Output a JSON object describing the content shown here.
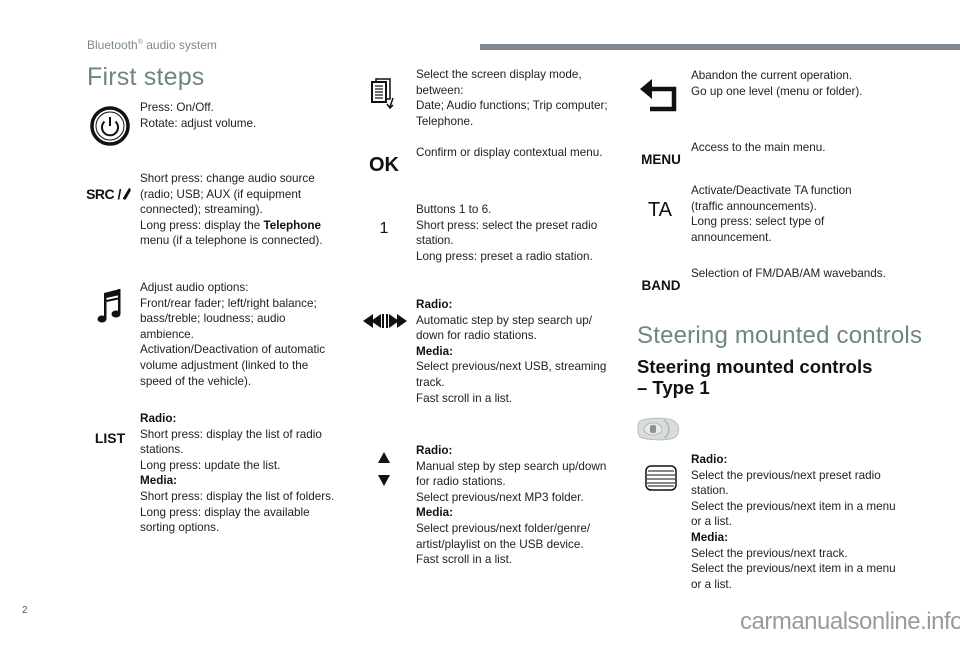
{
  "page": {
    "running_head": "Bluetooth",
    "running_head_reg": "®",
    "running_head_rest": " audio system",
    "page_number": "2",
    "watermark": "carmanualsonline.info",
    "header_bar_color": "#7d8a92",
    "heading_color": "#6f8583"
  },
  "first_steps": {
    "title": "First steps",
    "entries": [
      {
        "icon": "power-knob-icon",
        "lines": [
          {
            "bold": false,
            "text": "Press: On/Off."
          },
          {
            "bold": false,
            "text": "Rotate: adjust volume."
          }
        ]
      },
      {
        "icon": "src-telephone-icon",
        "icon_text": "SRC /",
        "lines": [
          {
            "bold": false,
            "text": "Short press: change audio source (radio; USB; AUX (if equipment connected); streaming)."
          },
          {
            "bold": false,
            "text": "Long press: display the ",
            "bold_suffix": "Telephone",
            "after": " menu (if a telephone is connected)."
          }
        ]
      },
      {
        "icon": "music-note-icon",
        "lines": [
          {
            "bold": false,
            "text": "Adjust audio options:"
          },
          {
            "bold": false,
            "text": "Front/rear fader; left/right balance; bass/treble; loudness; audio ambience."
          },
          {
            "bold": false,
            "text": "Activation/Deactivation of automatic volume adjustment (linked to the speed of the vehicle)."
          }
        ]
      },
      {
        "icon": "list-icon",
        "icon_text": "LIST",
        "lines": [
          {
            "bold": true,
            "text": "Radio:"
          },
          {
            "bold": false,
            "text": "Short press: display the list of radio stations."
          },
          {
            "bold": false,
            "text": "Long press: update the list."
          },
          {
            "bold": true,
            "text": "Media:"
          },
          {
            "bold": false,
            "text": "Short press: display the list of folders."
          },
          {
            "bold": false,
            "text": "Long press: display the available sorting options."
          }
        ]
      }
    ]
  },
  "middle_column": {
    "entries": [
      {
        "icon": "display-mode-icon",
        "lines": [
          {
            "bold": false,
            "text": "Select the screen display mode, between:"
          },
          {
            "bold": false,
            "text": "Date; Audio functions; Trip computer; Telephone."
          }
        ]
      },
      {
        "icon": "ok-icon",
        "icon_text": "OK",
        "lines": [
          {
            "bold": false,
            "text": "Confirm or display contextual menu."
          }
        ]
      },
      {
        "icon": "preset-button-icon",
        "icon_text": "1",
        "lines": [
          {
            "bold": false,
            "text": "Buttons 1 to 6."
          },
          {
            "bold": false,
            "text": "Short press: select the preset radio station."
          },
          {
            "bold": false,
            "text": "Long press: preset a radio station."
          }
        ]
      },
      {
        "icon": "seek-back-forward-icon",
        "lines": [
          {
            "bold": true,
            "text": "Radio:"
          },
          {
            "bold": false,
            "text": "Automatic step by step search up/ down for radio stations."
          },
          {
            "bold": true,
            "text": "Media:"
          },
          {
            "bold": false,
            "text": "Select previous/next USB, streaming track."
          },
          {
            "bold": false,
            "text": "Fast scroll in a list."
          }
        ]
      },
      {
        "icon": "up-down-arrows-icon",
        "lines": [
          {
            "bold": true,
            "text": "Radio:"
          },
          {
            "bold": false,
            "text": "Manual step by step search up/down for radio stations."
          },
          {
            "bold": false,
            "text": "Select previous/next MP3 folder."
          },
          {
            "bold": true,
            "text": "Media:"
          },
          {
            "bold": false,
            "text": "Select previous/next folder/genre/ artist/playlist on the USB device."
          },
          {
            "bold": false,
            "text": "Fast scroll in a list."
          }
        ]
      }
    ]
  },
  "right_column": {
    "entries": [
      {
        "icon": "back-arrow-icon",
        "lines": [
          {
            "bold": false,
            "text": "Abandon the current operation."
          },
          {
            "bold": false,
            "text": "Go up one level (menu or folder)."
          }
        ]
      },
      {
        "icon": "menu-icon",
        "icon_text": "MENU",
        "lines": [
          {
            "bold": false,
            "text": "Access to the main menu."
          }
        ]
      },
      {
        "icon": "ta-icon",
        "icon_text": "TA",
        "lines": [
          {
            "bold": false,
            "text": "Activate/Deactivate TA function (traffic announcements)."
          },
          {
            "bold": false,
            "text": "Long press: select type of announcement."
          }
        ]
      },
      {
        "icon": "band-icon",
        "icon_text": "BAND",
        "lines": [
          {
            "bold": false,
            "text": "Selection of FM/DAB/AM wavebands."
          }
        ]
      }
    ],
    "steering": {
      "title": "Steering mounted controls",
      "subtitle_line1": "Steering mounted controls",
      "subtitle_line2": "– Type 1",
      "entry": {
        "icon": "thumbwheel-icon",
        "lines": [
          {
            "bold": true,
            "text": "Radio:"
          },
          {
            "bold": false,
            "text": "Select the previous/next preset radio station."
          },
          {
            "bold": false,
            "text": "Select the previous/next item in a menu or a list."
          },
          {
            "bold": true,
            "text": "Media:"
          },
          {
            "bold": false,
            "text": "Select the previous/next track."
          },
          {
            "bold": false,
            "text": "Select the previous/next item in a menu or a list."
          }
        ]
      }
    }
  }
}
